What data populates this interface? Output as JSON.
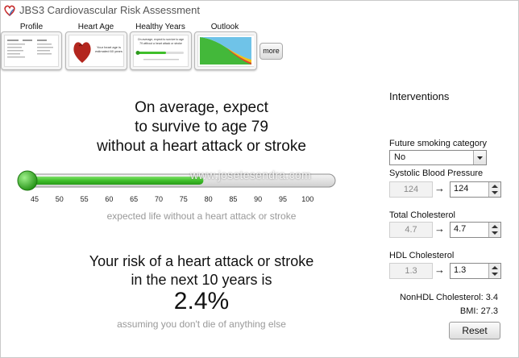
{
  "app": {
    "title": "JBS3 Cardiovascular Risk Assessment"
  },
  "tabs": [
    {
      "label": "Profile"
    },
    {
      "label": "Heart Age"
    },
    {
      "label": "Healthy Years"
    },
    {
      "label": "Outlook"
    }
  ],
  "thumbs": {
    "heart_age_text": "Your heart age is estimated 60 years",
    "healthy_years_text": "On average, expect to survive to age 79 without a heart attack or stroke"
  },
  "more_label": "more",
  "healthy_years": {
    "headline": [
      "On average, expect",
      "to survive to age 79",
      "without a heart attack or stroke"
    ],
    "slider": {
      "ticks": [
        "45",
        "50",
        "55",
        "60",
        "65",
        "70",
        "75",
        "80",
        "85",
        "90",
        "95",
        "100"
      ],
      "min": 45,
      "max": 100,
      "value": 79,
      "fill_color": "#3fbf2a"
    },
    "caption": "expected life without a heart attack or stroke"
  },
  "risk": {
    "lines": [
      "Your risk of a heart attack or stroke",
      "in the next 10 years is"
    ],
    "value": "2.4%",
    "note": "assuming you don't die of anything else"
  },
  "interventions": {
    "heading": "Interventions",
    "smoking": {
      "label": "Future smoking category",
      "value": "No"
    },
    "sbp": {
      "label": "Systolic Blood Pressure",
      "current": "124",
      "target": "124"
    },
    "tc": {
      "label": "Total Cholesterol",
      "current": "4.7",
      "target": "4.7"
    },
    "hdl": {
      "label": "HDL Cholesterol",
      "current": "1.3",
      "target": "1.3"
    },
    "arrow": "→",
    "nonhdl": "NonHDL Cholesterol: 3.4",
    "bmi": "BMI: 27.3",
    "reset_label": "Reset"
  },
  "watermark": "www.josetesendra.com",
  "colors": {
    "accent_green": "#3fbf2a",
    "dark_green": "#2e9a1e",
    "muted": "#999999"
  }
}
